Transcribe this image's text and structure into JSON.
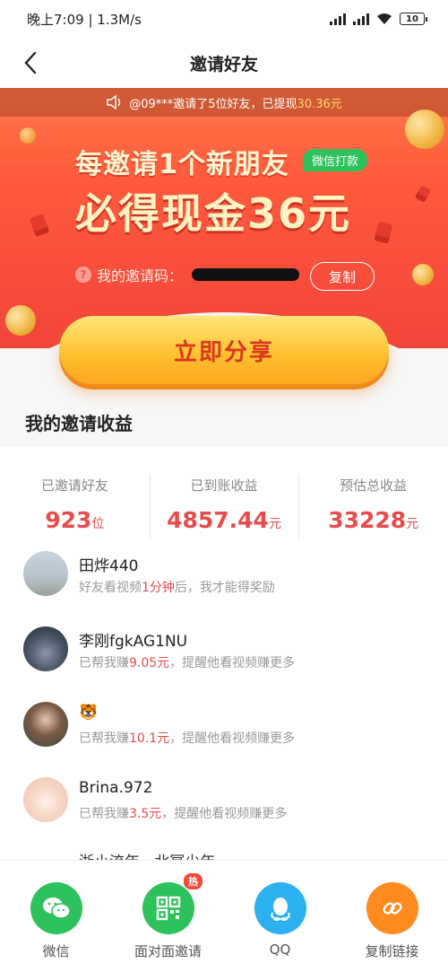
{
  "status_bar": {
    "time_speed": "晚上7:09 | 1.3M/s",
    "battery": "10"
  },
  "nav": {
    "title": "邀请好友",
    "back_icon": "chevron-left-icon"
  },
  "banner": {
    "ticker_text": "@09***邀请了5位好友，已提现",
    "ticker_amount": "30.36元",
    "headline_1": "每邀请1个新朋友",
    "wechat_tag": "微信打款",
    "headline_2": "必得现金36元",
    "code_label": "我的邀请码：",
    "copy_label": "复制"
  },
  "share_button": "立即分享",
  "section_title": "我的邀请收益",
  "stats": [
    {
      "label": "已邀请好友",
      "value": "923",
      "unit": "位"
    },
    {
      "label": "已到账收益",
      "value": "4857.44",
      "unit": "元"
    },
    {
      "label": "预估总收益",
      "value": "33228",
      "unit": "元"
    }
  ],
  "friends": [
    {
      "name": "田烨440",
      "desc_pre": "好友看视频",
      "desc_hl": "1分钟",
      "desc_post": "后，我才能得奖励"
    },
    {
      "name": "李刚fgkAG1NU",
      "desc_pre": "已帮我赚",
      "desc_hl": "9.05元",
      "desc_post": "，提醒他看视频赚更多"
    },
    {
      "name": "🐯",
      "desc_pre": "已帮我赚",
      "desc_hl": "10.1元",
      "desc_post": "，提醒他看视频赚更多"
    },
    {
      "name": "Brina.972",
      "desc_pre": "已帮我赚",
      "desc_hl": "3.5元",
      "desc_post": "，提醒他看视频赚更多"
    }
  ],
  "peek_text": "浙小流年 · 北冥少年",
  "bottom_bar": [
    {
      "label": "微信",
      "icon": "wechat-icon",
      "color": "#2ec25d"
    },
    {
      "label": "面对面邀请",
      "icon": "qrcode-icon",
      "color": "#2ec25d",
      "badge": "热"
    },
    {
      "label": "QQ",
      "icon": "qq-icon",
      "color": "#2bb0f0"
    },
    {
      "label": "复制链接",
      "icon": "link-icon",
      "color": "#ff8a1e"
    }
  ]
}
